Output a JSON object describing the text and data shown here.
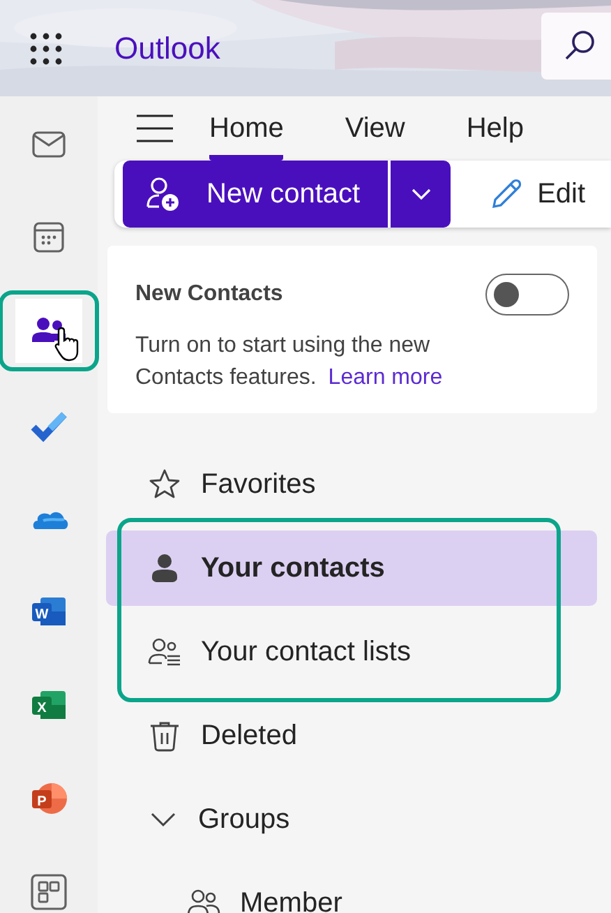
{
  "header": {
    "app_name": "Outlook"
  },
  "rail": [
    {
      "kind": "mail",
      "selected": false,
      "highlighted": false,
      "hovered": false
    },
    {
      "kind": "calendar",
      "selected": false,
      "highlighted": false,
      "hovered": false
    },
    {
      "kind": "people",
      "selected": true,
      "highlighted": true,
      "hovered": true
    },
    {
      "kind": "todo",
      "selected": false,
      "highlighted": false,
      "hovered": false
    },
    {
      "kind": "onedrive",
      "selected": false,
      "highlighted": false,
      "hovered": false
    },
    {
      "kind": "word",
      "selected": false,
      "highlighted": false,
      "hovered": false,
      "letter": "W"
    },
    {
      "kind": "excel",
      "selected": false,
      "highlighted": false,
      "hovered": false,
      "letter": "X"
    },
    {
      "kind": "powerpoint",
      "selected": false,
      "highlighted": false,
      "hovered": false,
      "letter": "P"
    },
    {
      "kind": "apps",
      "selected": false,
      "highlighted": false,
      "hovered": false
    }
  ],
  "tabs": [
    {
      "label": "Home",
      "selected": true
    },
    {
      "label": "View",
      "selected": false
    },
    {
      "label": "Help",
      "selected": false
    }
  ],
  "ribbon": {
    "primary": "New contact",
    "edit": "Edit"
  },
  "notice": {
    "title": "New Contacts",
    "on": false,
    "text": "Turn on to start using the new Contacts features.",
    "link": "Learn more"
  },
  "nav": [
    {
      "kind": "star",
      "label": "Favorites",
      "selected": false
    },
    {
      "kind": "callout",
      "children": [
        {
          "kind": "person",
          "label": "Your contacts",
          "selected": true
        },
        {
          "kind": "contactlist",
          "label": "Your contact lists",
          "selected": false
        }
      ]
    },
    {
      "kind": "trash",
      "label": "Deleted",
      "selected": false
    },
    {
      "kind": "group",
      "label": "Groups",
      "expanded": true,
      "children": [
        {
          "kind": "people",
          "label": "Member",
          "selected": false
        }
      ]
    }
  ]
}
